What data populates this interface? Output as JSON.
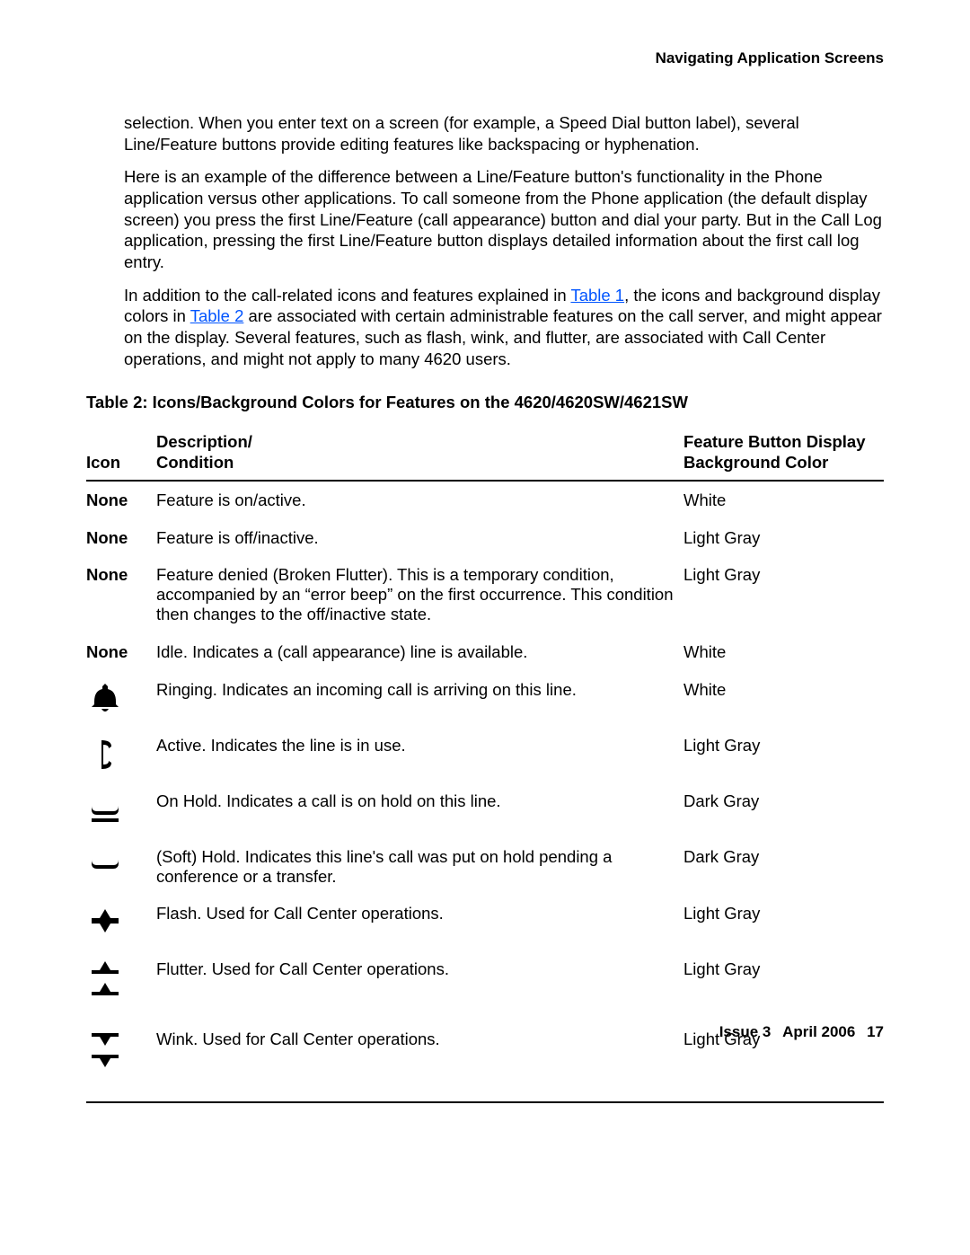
{
  "header": {
    "title": "Navigating Application Screens"
  },
  "paragraphs": {
    "p1": "selection. When you enter text on a screen (for example, a Speed Dial button label), several Line/Feature buttons provide editing features like backspacing or hyphenation.",
    "p2": "Here is an example of the difference between a Line/Feature button's functionality in the Phone application versus other applications. To call someone from the Phone application (the default display screen) you press the first Line/Feature (call appearance) button and dial your party. But in the Call Log application, pressing the first Line/Feature button displays detailed information about the first call log entry.",
    "p3a": "In addition to the call-related icons and features explained in ",
    "p3_link1": "Table 1",
    "p3b": ", the icons and background display colors in ",
    "p3_link2": "Table 2",
    "p3c": " are associated with certain administrable features on the call server, and might appear on the display. Several features, such as flash, wink, and flutter, are associated with Call Center operations, and might not apply to many 4620 users."
  },
  "table": {
    "caption": "Table 2:  Icons/Background Colors for Features on the 4620/4620SW/4621SW",
    "headers": {
      "icon": "Icon",
      "desc1": "Description/",
      "desc2": "Condition",
      "color1": "Feature Button Display",
      "color2": "Background Color"
    },
    "rows": [
      {
        "iconText": "None",
        "iconSvg": "",
        "desc": "Feature is on/active.",
        "color": "White"
      },
      {
        "iconText": "None",
        "iconSvg": "",
        "desc": "Feature is off/inactive.",
        "color": "Light Gray"
      },
      {
        "iconText": "None",
        "iconSvg": "",
        "desc": "Feature denied (Broken Flutter). This is a temporary condition, accompanied by an “error beep” on the first occurrence. This condition then changes to the off/inactive state.",
        "color": "Light Gray"
      },
      {
        "iconText": "None",
        "iconSvg": "",
        "desc": "Idle. Indicates a (call appearance) line is available.",
        "color": "White"
      },
      {
        "iconText": "",
        "iconSvg": "bell",
        "desc": "Ringing. Indicates an incoming call is arriving on this line.",
        "color": "White"
      },
      {
        "iconText": "",
        "iconSvg": "handset",
        "desc": "Active. Indicates the line is in use.",
        "color": "Light Gray"
      },
      {
        "iconText": "",
        "iconSvg": "holdbar",
        "desc": "On Hold. Indicates a call is on hold on this line.",
        "color": "Dark Gray"
      },
      {
        "iconText": "",
        "iconSvg": "softhold",
        "desc": "(Soft) Hold. Indicates this line's call was put on hold pending a conference or a transfer.",
        "color": "Dark Gray"
      },
      {
        "iconText": "",
        "iconSvg": "flash",
        "desc": "Flash. Used for Call Center operations.",
        "color": "Light Gray"
      },
      {
        "iconText": "",
        "iconSvg": "flutter",
        "desc": "Flutter. Used for Call Center operations.",
        "color": "Light Gray"
      },
      {
        "iconText": "",
        "iconSvg": "wink",
        "desc": "Wink. Used for Call Center operations.",
        "color": "Light Gray"
      }
    ]
  },
  "footer": {
    "issue": "Issue 3",
    "date": "April 2006",
    "page": "17"
  }
}
